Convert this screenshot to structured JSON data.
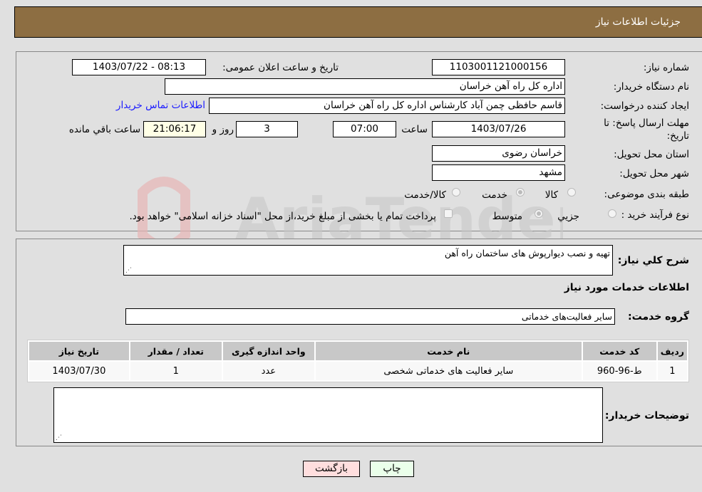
{
  "header": {
    "title": "جزئیات اطلاعات نیاز"
  },
  "form": {
    "need_number_label": "شماره نیاز:",
    "need_number": "1103001121000156",
    "announce_label": "تاریخ و ساعت اعلان عمومی:",
    "announce_value": "1403/07/22 - 08:13",
    "buyer_org_label": "نام دستگاه خریدار:",
    "buyer_org": "اداره کل راه آهن خراسان",
    "creator_label": "ایجاد کننده درخواست:",
    "creator": "قاسم حافظی چمن آباد کارشناس اداره کل راه آهن خراسان",
    "contact_link": "اطلاعات تماس خریدار",
    "deadline_label_line1": "مهلت ارسال پاسخ: تا",
    "deadline_label_line2": "تاریخ:",
    "deadline_date": "1403/07/26",
    "time_label": "ساعت",
    "deadline_time": "07:00",
    "days_value": "3",
    "days_label": "روز و",
    "remaining_time": "21:06:17",
    "remaining_label": "ساعت باقي مانده",
    "province_label": "استان محل تحویل:",
    "province": "خراسان رضوی",
    "city_label": "شهر محل تحویل:",
    "city": "مشهد",
    "category_label": "طبقه بندی موضوعی:",
    "category_options": [
      "کالا",
      "خدمت",
      "کالا/خدمت"
    ],
    "category_selected": "خدمت",
    "process_label": "نوع فرآیند خرید :",
    "process_options": [
      "جزيي",
      "متوسط"
    ],
    "process_selected": "متوسط",
    "treasury_note": "پرداخت تمام یا بخشی از مبلغ خرید،از محل \"اسناد خزانه اسلامی\" خواهد بود."
  },
  "details": {
    "summary_label": "شرح کلي نياز:",
    "summary": "تهیه و نصب دیوارپوش های ساختمان راه آهن",
    "services_heading": "اطلاعات خدمات مورد نیاز",
    "service_group_label": "گروه خدمت:",
    "service_group": "سایر فعالیت‌های خدماتی",
    "table": {
      "headers": [
        "ردیف",
        "کد خدمت",
        "نام خدمت",
        "واحد اندازه گیری",
        "تعداد / مقدار",
        "تاریخ نیاز"
      ],
      "rows": [
        [
          "1",
          "ط-96-960",
          "سایر فعالیت های خدماتی شخصی",
          "عدد",
          "1",
          "1403/07/30"
        ]
      ]
    },
    "buyer_notes_label": "توضیحات خریدار:",
    "buyer_notes": ""
  },
  "buttons": {
    "print": "چاپ",
    "back": "بازگشت"
  },
  "colors": {
    "header_bg": "#8d6e42",
    "print_bg": "#eaffea",
    "back_bg": "#ffdede",
    "link": "#1a1aff"
  }
}
